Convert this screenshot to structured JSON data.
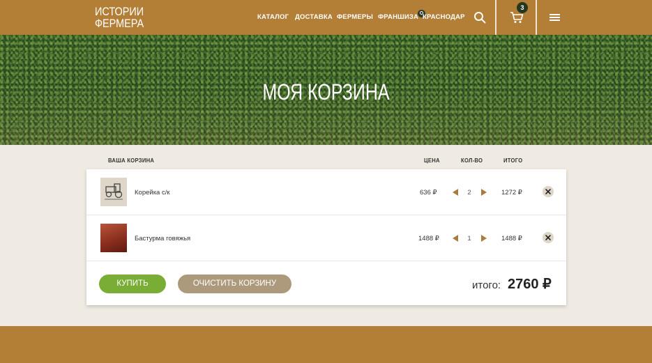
{
  "header": {
    "logo_line1": "ИСТОРИИ",
    "logo_line2": "ФЕРМЕРА",
    "nav": [
      "КАТАЛОГ",
      "ДОСТАВКА",
      "ФЕРМЕРЫ",
      "ФРАНШИЗА"
    ],
    "city": "КРАСНОДАР",
    "cart_count": "3",
    "icons": [
      "location-pin-icon",
      "search-icon",
      "cart-icon",
      "menu-icon"
    ],
    "brand_color": "#b37f37"
  },
  "hero": {
    "title": "МОЯ КОРЗИНА"
  },
  "cart": {
    "columns": {
      "title": "ВАША КОРЗИНА",
      "price": "ЦЕНА",
      "qty": "КОЛ-ВО",
      "total": "ИТОГО"
    },
    "items": [
      {
        "name": "Корейка с/к",
        "price": "636 ₽",
        "qty": "2",
        "total": "1272 ₽"
      },
      {
        "name": "Бастурма говяжья",
        "price": "1488 ₽",
        "qty": "1",
        "total": "1488 ₽"
      }
    ],
    "buy_label": "КУПИТЬ",
    "clear_label": "ОЧИСТИТЬ КОРЗИНУ",
    "sum_label": "итого:",
    "sum_value": "2760 ₽",
    "buy_color": "#7aad35",
    "clear_color": "#ad9a7c"
  }
}
